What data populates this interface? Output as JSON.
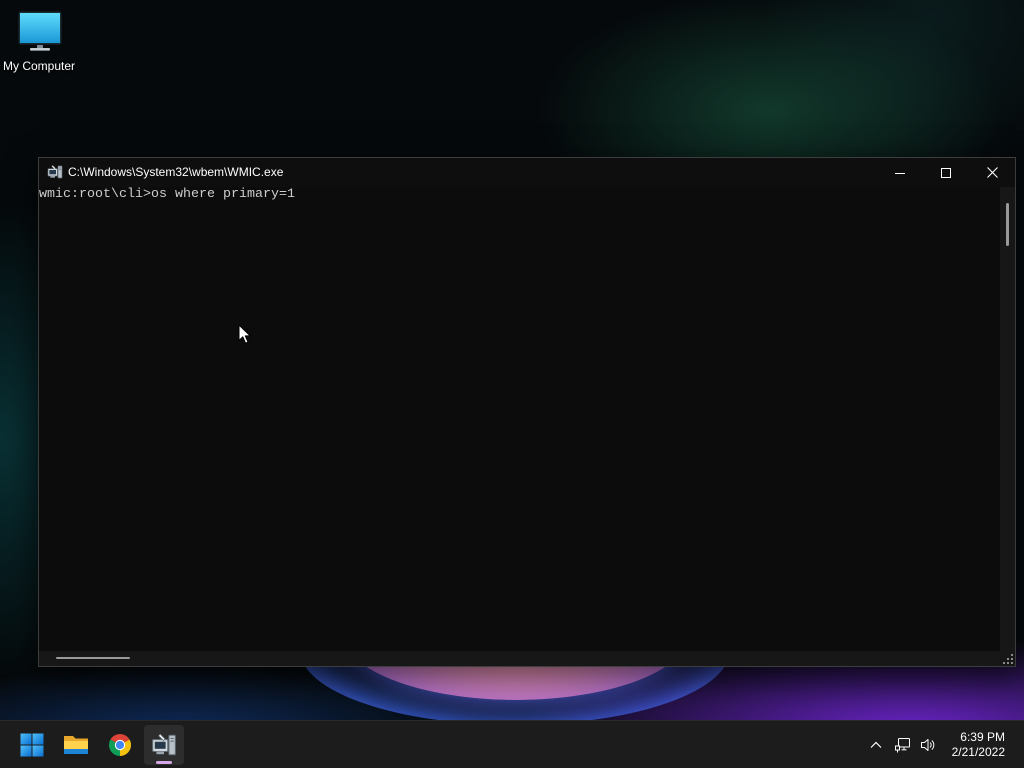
{
  "theme": {
    "console_background": "#0c0c0c",
    "console_text": "#cccccc",
    "titlebar_text": "#ffffff",
    "taskbar_background": "#1c1c1c",
    "active_indicator": "#d6a6e6"
  },
  "desktop": {
    "icons": [
      {
        "label": "My Computer",
        "icon": "my-computer-icon"
      }
    ]
  },
  "window": {
    "title": "C:\\Windows\\System32\\wbem\\WMIC.exe",
    "icon": "wmic-app-icon",
    "controls": [
      "minimize-icon",
      "maximize-icon",
      "close-icon"
    ],
    "console": {
      "lines": [
        "wmic:root\\cli>os where primary=1"
      ]
    }
  },
  "taskbar": {
    "pinned": [
      {
        "icon": "windows-start-icon",
        "active": false
      },
      {
        "icon": "file-explorer-folder-icon",
        "active": false
      },
      {
        "icon": "chrome-icon",
        "active": false
      },
      {
        "icon": "wmic-app-icon",
        "active": true
      }
    ],
    "tray": {
      "icons": [
        "chevron-up-icon",
        "network-icon",
        "volume-icon"
      ],
      "time": "6:39 PM",
      "date": "2/21/2022"
    }
  },
  "cursor": {
    "icon": "mouse-pointer-icon"
  }
}
